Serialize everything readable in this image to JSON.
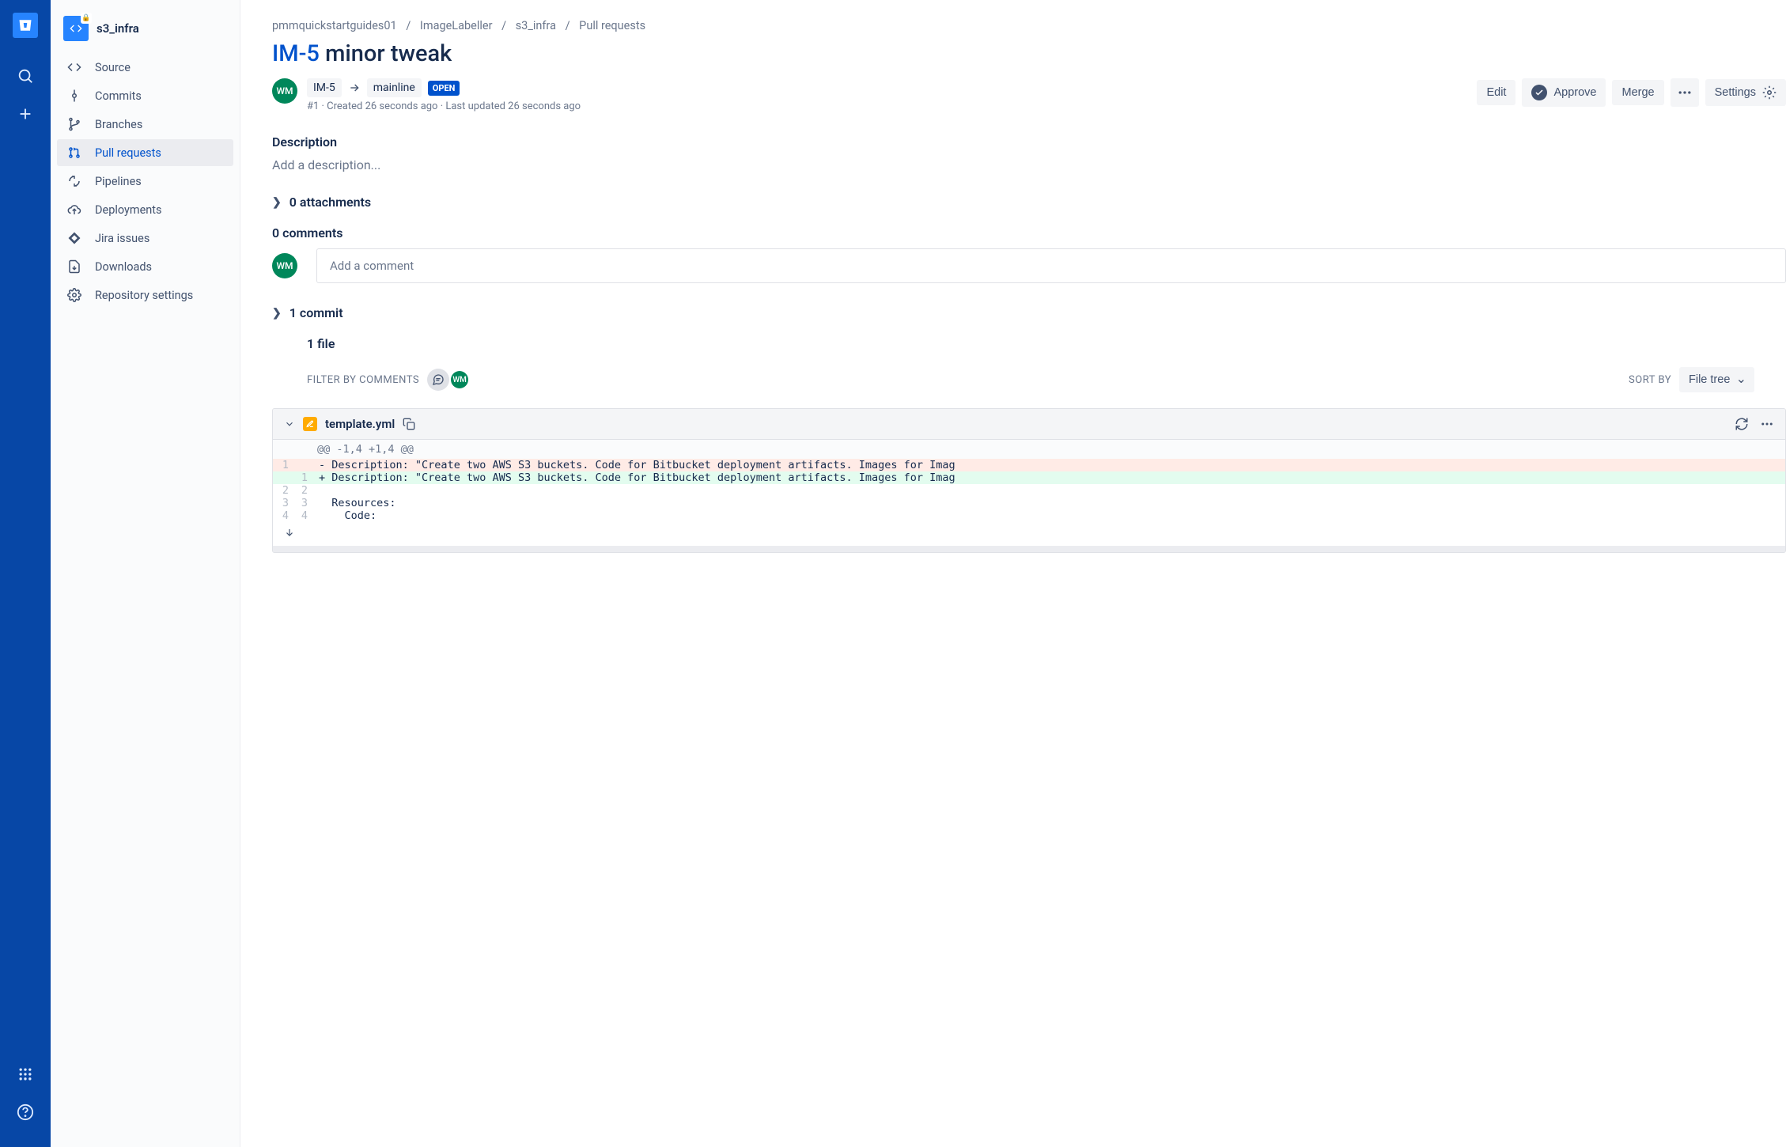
{
  "repo": {
    "name": "s3_infra",
    "avatar_initials": "</>"
  },
  "sidebar": {
    "items": [
      {
        "label": "Source"
      },
      {
        "label": "Commits"
      },
      {
        "label": "Branches"
      },
      {
        "label": "Pull requests"
      },
      {
        "label": "Pipelines"
      },
      {
        "label": "Deployments"
      },
      {
        "label": "Jira issues"
      },
      {
        "label": "Downloads"
      },
      {
        "label": "Repository settings"
      }
    ]
  },
  "breadcrumb": {
    "workspace": "pmmquickstartguides01",
    "project": "ImageLabeller",
    "repo": "s3_infra",
    "section": "Pull requests"
  },
  "pr": {
    "key": "IM-5",
    "title_rest": " minor tweak",
    "source_branch": "IM-5",
    "dest_branch": "mainline",
    "state": "OPEN",
    "id": "#1",
    "created": "Created 26 seconds ago",
    "updated": "Last updated 26 seconds ago",
    "author_initials": "WM"
  },
  "actions": {
    "edit": "Edit",
    "approve": "Approve",
    "merge": "Merge",
    "settings": "Settings"
  },
  "description": {
    "heading": "Description",
    "placeholder": "Add a description..."
  },
  "attachments": {
    "label": "0 attachments"
  },
  "comments": {
    "heading": "0 comments",
    "placeholder": "Add a comment"
  },
  "commits": {
    "label": "1 commit"
  },
  "files": {
    "heading": "1 file",
    "filter_label": "FILTER BY COMMENTS",
    "sort_label": "SORT BY",
    "sort_value": "File tree"
  },
  "diff": {
    "file_name": "template.yml",
    "hunk": "@@ -1,4 +1,4 @@",
    "lines": [
      {
        "old": "1",
        "new": "",
        "type": "del",
        "text": "Description: \"Create two AWS S3 buckets. Code for Bitbucket deployment artifacts. Images for Imag"
      },
      {
        "old": "",
        "new": "1",
        "type": "add",
        "text": "Description: \"Create two AWS S3 buckets. Code for Bitbucket deployment artifacts. Images for Imag"
      },
      {
        "old": "2",
        "new": "2",
        "type": "ctx",
        "text": ""
      },
      {
        "old": "3",
        "new": "3",
        "type": "ctx",
        "text": "Resources:"
      },
      {
        "old": "4",
        "new": "4",
        "type": "ctx",
        "text": "  Code:"
      }
    ]
  }
}
